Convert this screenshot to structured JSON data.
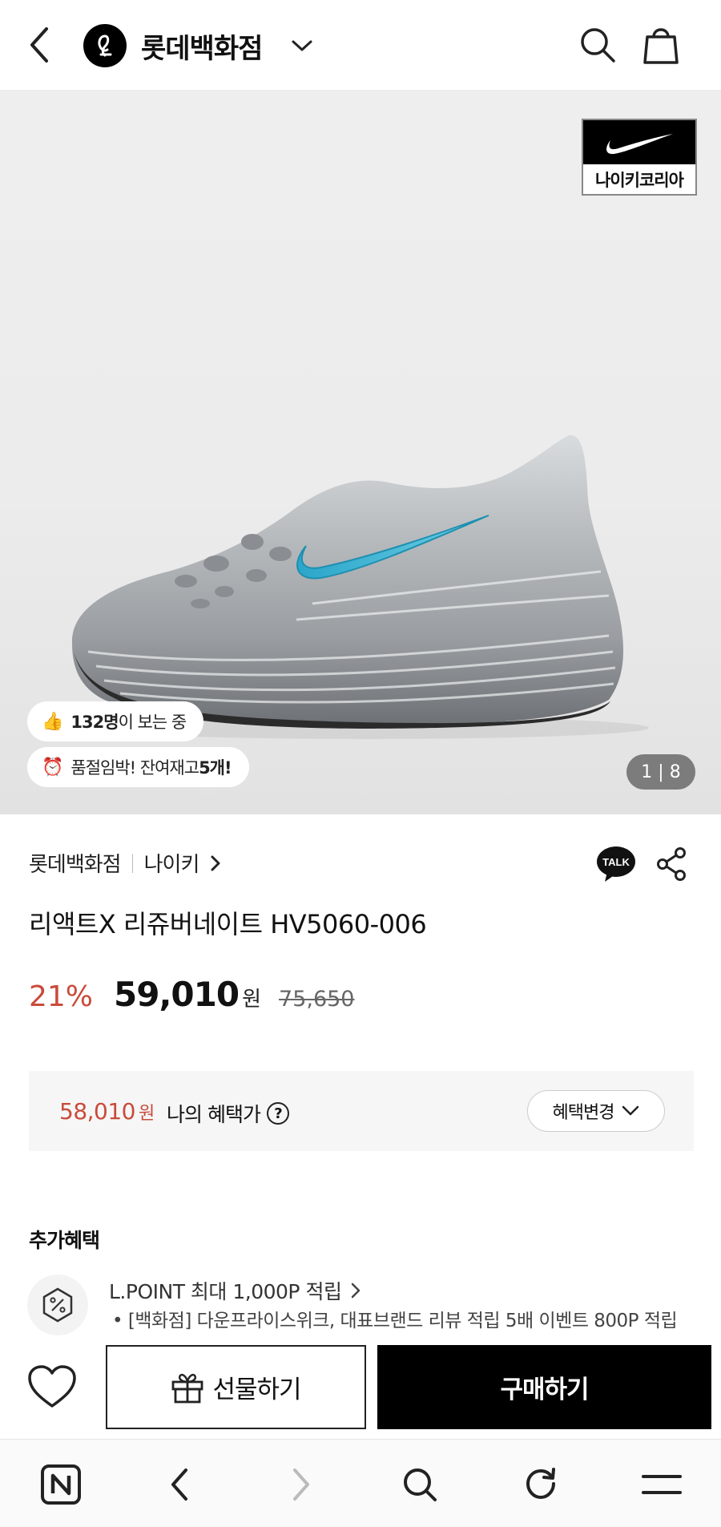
{
  "header": {
    "brand_title": "롯데백화점"
  },
  "hero": {
    "badge_label": "나이키코리아",
    "viewers_count": "132명",
    "viewers_suffix": "이 보는 중",
    "stock_prefix": "품절임박! 잔여재고 ",
    "stock_count": "5개!",
    "page_counter": "1 | 8"
  },
  "product": {
    "store": "롯데백화점",
    "brand": "나이키",
    "name": "리액트X 리쥬버네이트 HV5060-006",
    "discount": "21%",
    "price": "59,010",
    "currency": "원",
    "original_price": "75,650"
  },
  "benefit": {
    "my_price": "58,010",
    "currency": "원",
    "label": "나의 혜택가",
    "change_button": "혜택변경"
  },
  "extra": {
    "title": "추가혜택",
    "lpoint_title": "L.POINT 최대 1,000P 적립",
    "lpoint_desc": "• [백화점] 다운프라이스위크, 대표브랜드 리뷰 적립 5배 이벤트 800P 적립"
  },
  "actions": {
    "gift_label": "선물하기",
    "buy_label": "구매하기"
  },
  "colors": {
    "accent_red": "#c94b3a",
    "buy_button": "#000000",
    "swoosh": "#3bb6d6"
  }
}
